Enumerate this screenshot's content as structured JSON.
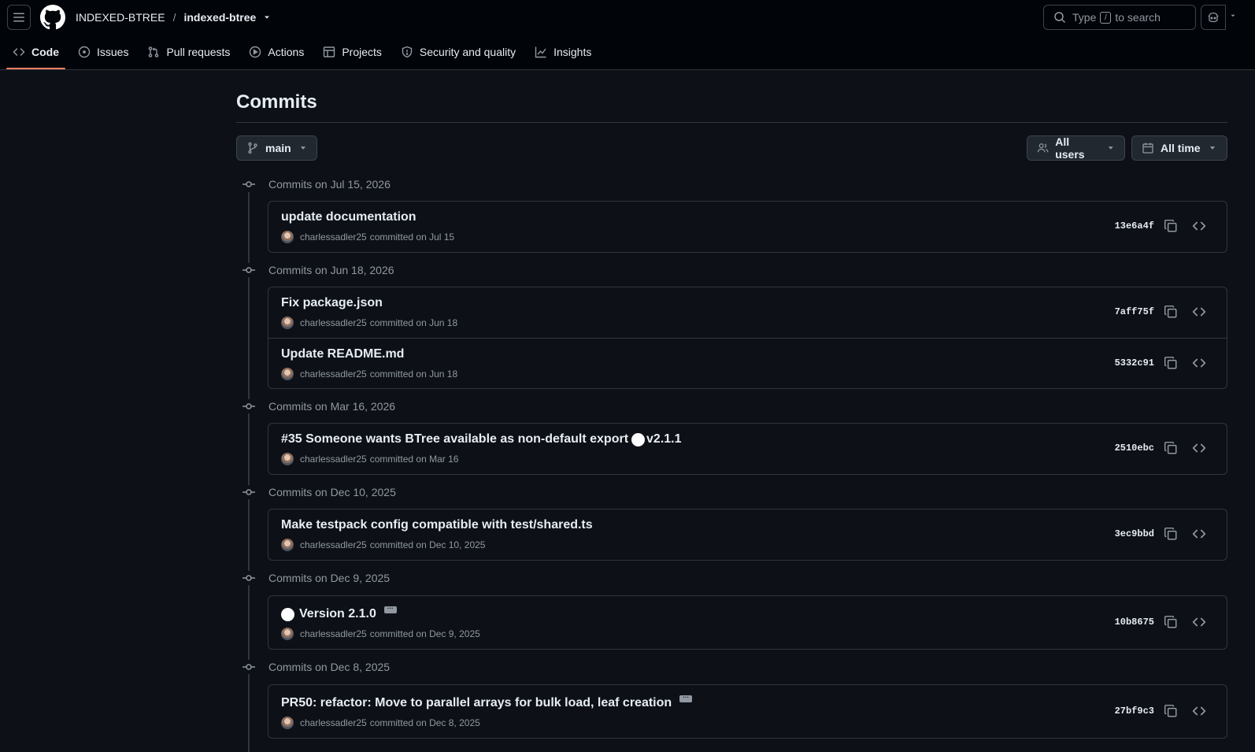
{
  "header": {
    "owner": "INDEXED-BTREE",
    "separator": "/",
    "repo": "indexed-btree",
    "search_prefix": "Type",
    "search_key": "/",
    "search_suffix": "to search"
  },
  "tabs": [
    {
      "label": "Code",
      "icon": "code-icon",
      "active": true
    },
    {
      "label": "Issues",
      "icon": "issue-opened-icon"
    },
    {
      "label": "Pull requests",
      "icon": "git-pull-request-icon"
    },
    {
      "label": "Actions",
      "icon": "play-icon"
    },
    {
      "label": "Projects",
      "icon": "table-icon"
    },
    {
      "label": "Security and quality",
      "icon": "shield-icon"
    },
    {
      "label": "Insights",
      "icon": "graph-icon"
    }
  ],
  "page": {
    "title": "Commits",
    "branch": "main",
    "users_filter": "All users",
    "time_filter": "All time"
  },
  "groups": [
    {
      "heading": "Commits on Jul 15, 2026",
      "commits": [
        {
          "message": "update documentation",
          "author": "charlessadler25",
          "date": "committed on Jul 15",
          "sha": "13e6a4f"
        }
      ]
    },
    {
      "heading": "Commits on Jun 18, 2026",
      "commits": [
        {
          "message": "Fix package.json",
          "author": "charlessadler25",
          "date": "committed on Jun 18",
          "sha": "7aff75f"
        },
        {
          "message": "Update README.md",
          "author": "charlessadler25",
          "date": "committed on Jun 18",
          "sha": "5332c91"
        }
      ]
    },
    {
      "heading": "Commits on Mar 16, 2026",
      "commits": [
        {
          "message": "#35 Someone wants BTree available as non-default export",
          "suffix": "v2.1.1",
          "author": "charlessadler25",
          "date": "committed on Mar 16",
          "sha": "2510ebc"
        }
      ]
    },
    {
      "heading": "Commits on Dec 10, 2025",
      "commits": [
        {
          "message": "Make testpack config compatible with test/shared.ts",
          "author": "charlessadler25",
          "date": "committed on Dec 10, 2025",
          "sha": "3ec9bbd"
        }
      ]
    },
    {
      "heading": "Commits on Dec 9, 2025",
      "commits": [
        {
          "message": "Version 2.1.0",
          "author": "charlessadler25",
          "date": "committed on Dec 9, 2025",
          "sha": "10b8675"
        }
      ]
    },
    {
      "heading": "Commits on Dec 8, 2025",
      "commits": [
        {
          "message": "PR50: refactor: Move to parallel arrays for bulk load, leaf creation",
          "author": "charlessadler25",
          "date": "committed on Dec 8, 2025",
          "sha": "27bf9c3"
        }
      ]
    }
  ],
  "colors": {
    "background": "#0d1117",
    "header_bg": "#010409",
    "border": "#30363d",
    "text": "#e6edf3",
    "muted": "#9198a1",
    "active_tab_underline": "#f78166"
  }
}
